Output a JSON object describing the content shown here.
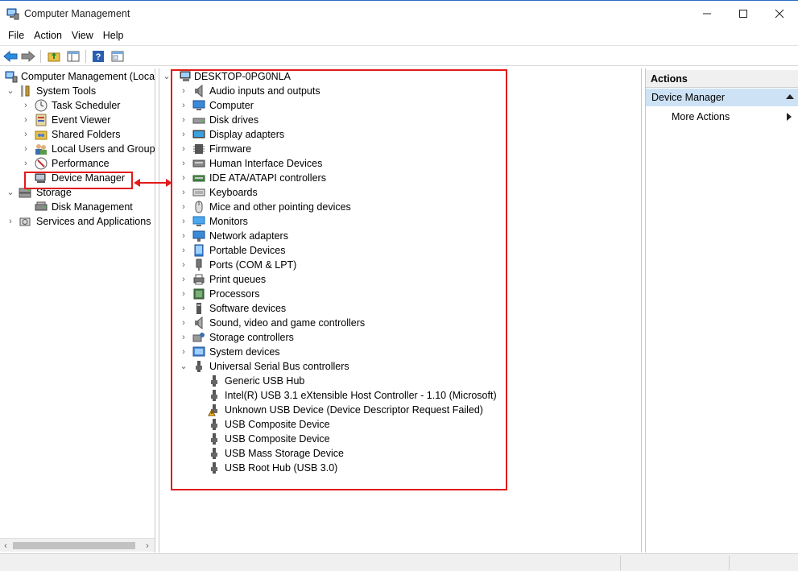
{
  "window": {
    "title": "Computer Management",
    "icon": "computer-management-icon"
  },
  "menu": [
    "File",
    "Action",
    "View",
    "Help"
  ],
  "toolbar": {
    "icons": [
      "back-arrow-icon",
      "forward-arrow-icon",
      "up-folder-icon",
      "show-hide-console-tree-icon",
      "help-icon",
      "properties-icon"
    ]
  },
  "left_tree": {
    "root": "Computer Management (Local",
    "items": [
      {
        "label": "System Tools",
        "icon": "tools-icon"
      },
      {
        "label": "Task Scheduler",
        "icon": "clock-icon"
      },
      {
        "label": "Event Viewer",
        "icon": "event-viewer-icon"
      },
      {
        "label": "Shared Folders",
        "icon": "shared-folder-icon"
      },
      {
        "label": "Local Users and Groups",
        "icon": "users-icon"
      },
      {
        "label": "Performance",
        "icon": "performance-icon"
      },
      {
        "label": "Device Manager",
        "icon": "device-manager-icon"
      },
      {
        "label": "Storage",
        "icon": "storage-icon"
      },
      {
        "label": "Disk Management",
        "icon": "disk-management-icon"
      },
      {
        "label": "Services and Applications",
        "icon": "services-icon"
      }
    ]
  },
  "device_tree": {
    "root": "DESKTOP-0PG0NLA",
    "categories": [
      "Audio inputs and outputs",
      "Computer",
      "Disk drives",
      "Display adapters",
      "Firmware",
      "Human Interface Devices",
      "IDE ATA/ATAPI controllers",
      "Keyboards",
      "Mice and other pointing devices",
      "Monitors",
      "Network adapters",
      "Portable Devices",
      "Ports (COM & LPT)",
      "Print queues",
      "Processors",
      "Software devices",
      "Sound, video and game controllers",
      "Storage controllers",
      "System devices",
      "Universal Serial Bus controllers"
    ],
    "usb_children": [
      "Generic USB Hub",
      "Intel(R) USB 3.1 eXtensible Host Controller - 1.10 (Microsoft)",
      "Unknown USB Device (Device Descriptor Request Failed)",
      "USB Composite Device",
      "USB Composite Device",
      "USB Mass Storage Device",
      "USB Root Hub (USB 3.0)"
    ]
  },
  "actions": {
    "header": "Actions",
    "selected": "Device Manager",
    "more": "More Actions"
  },
  "colors": {
    "annotation_red": "#e21b1b",
    "selection_blue": "#cde2f5",
    "title_accent": "#2b6cc4"
  }
}
